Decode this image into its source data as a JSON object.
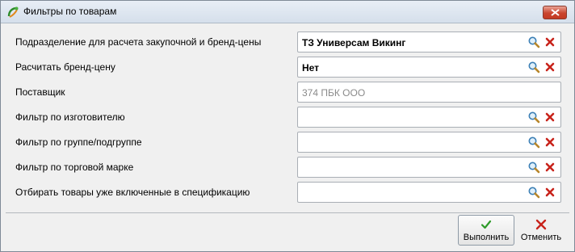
{
  "window": {
    "title": "Фильтры по товарам"
  },
  "filters": [
    {
      "label": "Подразделение для расчета закупочной и бренд-цены",
      "value": "ТЗ Универсам Викинг",
      "style": "bold",
      "has_actions": true
    },
    {
      "label": "Расчитать бренд-цену",
      "value": "Нет",
      "style": "bold",
      "has_actions": true
    },
    {
      "label": "Поставщик",
      "value": "374  ПБК ООО",
      "style": "gray",
      "has_actions": false
    },
    {
      "label": "Фильтр по изготовителю",
      "value": "",
      "style": "normal",
      "has_actions": true
    },
    {
      "label": "Фильтр по группе/подгруппе",
      "value": "",
      "style": "normal",
      "has_actions": true
    },
    {
      "label": "Фильтр по торговой марке",
      "value": "",
      "style": "normal",
      "has_actions": true
    },
    {
      "label": "Отбирать товары уже включенные в спецификацию",
      "value": "",
      "style": "normal",
      "has_actions": true
    }
  ],
  "footer": {
    "run_label": "Выполнить",
    "cancel_label": "Отменить"
  },
  "icons": {
    "search": "magnifier-icon",
    "clear": "red-x-icon",
    "run": "green-check-icon",
    "cancel": "red-cross-icon"
  },
  "colors": {
    "clear_red": "#c8231b",
    "run_green": "#2e9b2a",
    "titlebar": "#dbe4ee"
  }
}
